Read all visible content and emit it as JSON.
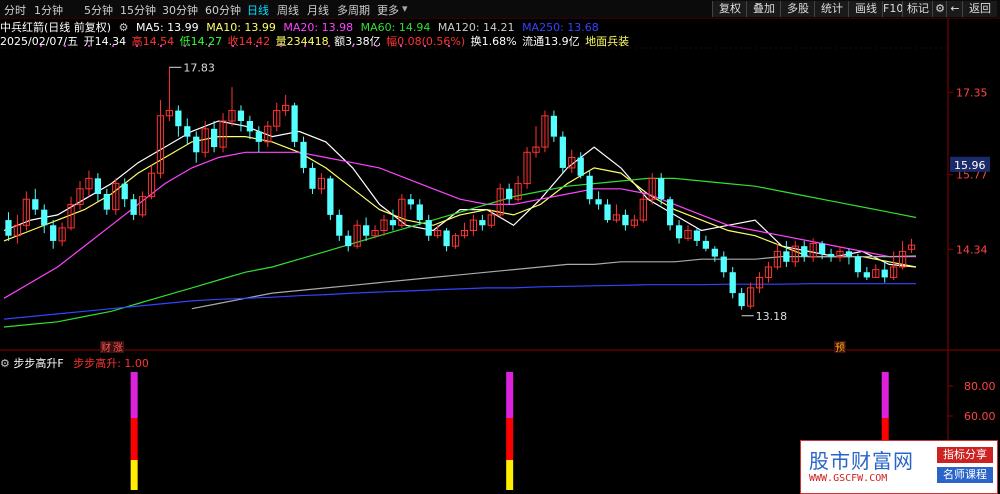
{
  "toolbar": {
    "timeframes": [
      "分时",
      "1分钟",
      "5分钟",
      "15分钟",
      "30分钟",
      "60分钟",
      "日线",
      "周线",
      "月线",
      "多周期",
      "更多"
    ],
    "active_timeframe": "日线",
    "buttons": [
      "复权",
      "叠加",
      "多股",
      "统计",
      "画线",
      "F10",
      "标记"
    ],
    "gear_icon": "gear-icon",
    "back_button": "返回"
  },
  "header": {
    "title": "中兵红箭(日线 前复权)",
    "ma_items": [
      {
        "label": "MA5: 13.99",
        "color": "#ffffff"
      },
      {
        "label": "MA10: 13.99",
        "color": "#ffff66"
      },
      {
        "label": "MA20: 13.98",
        "color": "#ff44ff"
      },
      {
        "label": "MA60: 14.94",
        "color": "#33dd33"
      },
      {
        "label": "MA120: 14.21",
        "color": "#cccccc"
      },
      {
        "label": "MA250: 13.68",
        "color": "#3344ff"
      }
    ],
    "date": "2025/02/07/五",
    "quote_items": [
      {
        "label": "开14.34",
        "color": "#ffffff"
      },
      {
        "label": "高14.54",
        "color": "#ff3333"
      },
      {
        "label": "低14.27",
        "color": "#33ff33"
      },
      {
        "label": "收14.42",
        "color": "#ff3333"
      },
      {
        "label": "量234418",
        "color": "#ffff66"
      },
      {
        "label": "额3.38亿",
        "color": "#ffffff"
      },
      {
        "label": "幅0.08(0.56%)",
        "color": "#ff3333"
      },
      {
        "label": "换1.68%",
        "color": "#ffffff"
      },
      {
        "label": "流通13.9亿",
        "color": "#ffffff"
      },
      {
        "label": "地面兵装",
        "color": "#ffff66"
      }
    ]
  },
  "indicator": {
    "name": "步步高升F",
    "value_label": "步步高升: 1.00",
    "y_ticks": [
      "80.00",
      "60.00"
    ]
  },
  "annotations": {
    "high_label": "17.83",
    "low_label": "13.18",
    "marker_cai": "财",
    "marker_zhang": "涨",
    "marker_yu": "预"
  },
  "watermark": {
    "name": "股市财富网",
    "url": "WWW.GSCFW.COM",
    "tag1": "指标分享",
    "tag2": "名师课程"
  },
  "chart_data": {
    "type": "candlestick",
    "price_ticks": [
      "17.35",
      "15.77",
      "14.34"
    ],
    "current_price_label": "15.96",
    "ylim": [
      12.6,
      18.2
    ],
    "candles": [
      [
        14.9,
        14.6,
        15.05,
        14.5
      ],
      [
        14.6,
        14.8,
        15.0,
        14.45
      ],
      [
        14.8,
        15.3,
        15.45,
        14.7
      ],
      [
        15.3,
        15.1,
        15.5,
        15.0
      ],
      [
        15.1,
        14.8,
        15.2,
        14.65
      ],
      [
        14.8,
        14.5,
        14.9,
        14.35
      ],
      [
        14.5,
        14.75,
        14.85,
        14.4
      ],
      [
        14.75,
        15.2,
        15.35,
        14.7
      ],
      [
        15.2,
        15.5,
        15.65,
        15.1
      ],
      [
        15.5,
        15.7,
        15.85,
        15.35
      ],
      [
        15.7,
        15.4,
        15.8,
        15.25
      ],
      [
        15.4,
        15.1,
        15.5,
        15.0
      ],
      [
        15.1,
        15.6,
        15.7,
        15.0
      ],
      [
        15.6,
        15.3,
        15.7,
        15.15
      ],
      [
        15.3,
        15.0,
        15.4,
        14.9
      ],
      [
        15.0,
        15.35,
        15.45,
        14.95
      ],
      [
        15.35,
        15.8,
        15.95,
        15.3
      ],
      [
        15.8,
        16.9,
        17.2,
        15.7
      ],
      [
        16.9,
        17.0,
        17.83,
        16.8
      ],
      [
        17.0,
        16.7,
        17.1,
        16.5
      ],
      [
        16.7,
        16.5,
        16.85,
        16.35
      ],
      [
        16.5,
        16.2,
        16.6,
        16.0
      ],
      [
        16.2,
        16.65,
        16.8,
        16.1
      ],
      [
        16.65,
        16.3,
        16.8,
        16.2
      ],
      [
        16.3,
        16.8,
        16.95,
        16.2
      ],
      [
        16.8,
        17.0,
        17.45,
        16.7
      ],
      [
        17.0,
        16.8,
        17.1,
        16.6
      ],
      [
        16.8,
        16.6,
        16.9,
        16.45
      ],
      [
        16.6,
        16.4,
        16.7,
        16.2
      ],
      [
        16.4,
        16.7,
        16.8,
        16.3
      ],
      [
        16.7,
        17.0,
        17.15,
        16.6
      ],
      [
        17.0,
        17.1,
        17.3,
        16.9
      ],
      [
        17.1,
        16.4,
        17.15,
        16.3
      ],
      [
        16.4,
        15.9,
        16.5,
        15.8
      ],
      [
        15.9,
        15.5,
        16.0,
        15.4
      ],
      [
        15.5,
        15.7,
        15.8,
        15.4
      ],
      [
        15.7,
        15.0,
        15.75,
        14.9
      ],
      [
        15.0,
        14.6,
        15.1,
        14.5
      ],
      [
        14.6,
        14.4,
        14.7,
        14.3
      ],
      [
        14.4,
        14.8,
        14.9,
        14.35
      ],
      [
        14.8,
        14.6,
        14.95,
        14.5
      ],
      [
        14.6,
        14.7,
        14.8,
        14.55
      ],
      [
        14.7,
        14.9,
        15.0,
        14.6
      ],
      [
        14.9,
        14.8,
        15.1,
        14.7
      ],
      [
        14.8,
        15.3,
        15.4,
        14.75
      ],
      [
        15.3,
        15.2,
        15.4,
        15.1
      ],
      [
        15.2,
        14.9,
        15.3,
        14.8
      ],
      [
        14.9,
        14.6,
        15.0,
        14.5
      ],
      [
        14.6,
        14.7,
        14.8,
        14.55
      ],
      [
        14.7,
        14.4,
        14.75,
        14.3
      ],
      [
        14.4,
        14.6,
        14.65,
        14.35
      ],
      [
        14.6,
        14.7,
        14.85,
        14.55
      ],
      [
        14.7,
        14.9,
        15.0,
        14.6
      ],
      [
        14.9,
        14.8,
        15.0,
        14.7
      ],
      [
        14.8,
        15.0,
        15.1,
        14.75
      ],
      [
        15.0,
        15.5,
        15.6,
        14.95
      ],
      [
        15.5,
        15.3,
        15.6,
        15.2
      ],
      [
        15.3,
        15.6,
        15.75,
        15.25
      ],
      [
        15.6,
        16.2,
        16.3,
        15.5
      ],
      [
        16.2,
        16.3,
        16.7,
        16.1
      ],
      [
        16.3,
        16.9,
        17.0,
        16.2
      ],
      [
        16.9,
        16.5,
        17.0,
        16.4
      ],
      [
        16.5,
        15.9,
        16.6,
        15.8
      ],
      [
        15.9,
        16.1,
        16.25,
        15.8
      ],
      [
        16.1,
        15.75,
        16.2,
        15.7
      ],
      [
        15.75,
        15.3,
        15.85,
        15.2
      ],
      [
        15.3,
        15.2,
        15.45,
        15.1
      ],
      [
        15.2,
        14.9,
        15.3,
        14.85
      ],
      [
        14.9,
        15.0,
        15.2,
        14.85
      ],
      [
        15.0,
        14.8,
        15.1,
        14.7
      ],
      [
        14.8,
        14.9,
        15.0,
        14.75
      ],
      [
        14.9,
        15.3,
        15.4,
        14.85
      ],
      [
        15.3,
        15.7,
        15.8,
        15.2
      ],
      [
        15.7,
        15.3,
        15.8,
        15.2
      ],
      [
        15.3,
        14.8,
        15.35,
        14.7
      ],
      [
        14.8,
        14.55,
        14.9,
        14.45
      ],
      [
        14.55,
        14.7,
        14.8,
        14.5
      ],
      [
        14.7,
        14.5,
        14.75,
        14.4
      ],
      [
        14.5,
        14.35,
        14.6,
        14.3
      ],
      [
        14.35,
        14.2,
        14.4,
        14.1
      ],
      [
        14.2,
        13.9,
        14.3,
        13.8
      ],
      [
        13.9,
        13.5,
        14.0,
        13.4
      ],
      [
        13.5,
        13.25,
        13.6,
        13.18
      ],
      [
        13.25,
        13.6,
        13.7,
        13.2
      ],
      [
        13.6,
        13.8,
        13.9,
        13.5
      ],
      [
        13.8,
        14.0,
        14.1,
        13.7
      ],
      [
        14.0,
        14.3,
        14.45,
        13.95
      ],
      [
        14.3,
        14.1,
        14.5,
        14.0
      ],
      [
        14.1,
        14.4,
        14.5,
        14.0
      ],
      [
        14.4,
        14.2,
        14.5,
        14.1
      ],
      [
        14.2,
        14.45,
        14.55,
        14.1
      ],
      [
        14.45,
        14.25,
        14.5,
        14.15
      ],
      [
        14.25,
        14.2,
        14.35,
        14.1
      ],
      [
        14.2,
        14.3,
        14.4,
        14.1
      ],
      [
        14.3,
        14.2,
        14.35,
        14.05
      ],
      [
        14.2,
        13.9,
        14.25,
        13.8
      ],
      [
        13.9,
        13.8,
        14.0,
        13.75
      ],
      [
        13.8,
        13.95,
        14.05,
        13.8
      ],
      [
        13.95,
        13.8,
        14.1,
        13.7
      ],
      [
        13.8,
        14.0,
        14.3,
        13.75
      ],
      [
        14.0,
        14.3,
        14.5,
        13.95
      ],
      [
        14.34,
        14.42,
        14.54,
        14.27
      ]
    ],
    "ma_lines": [
      {
        "name": "MA5",
        "color": "#ffffff",
        "values": [
          14.7,
          14.9,
          15.0,
          15.3,
          15.6,
          16.0,
          16.3,
          16.6,
          16.8,
          16.7,
          16.5,
          16.6,
          16.4,
          15.9,
          15.2,
          14.8,
          14.7,
          15.1,
          15.1,
          14.8,
          15.3,
          15.9,
          16.3,
          15.9,
          15.3,
          15.0,
          14.7,
          14.8,
          14.9,
          14.4,
          14.3,
          14.2,
          14.3,
          14.05,
          14.0
        ]
      },
      {
        "name": "MA10",
        "color": "#ffff66",
        "values": [
          14.5,
          14.7,
          14.9,
          15.1,
          15.4,
          15.8,
          16.1,
          16.4,
          16.5,
          16.5,
          16.4,
          16.2,
          15.9,
          15.5,
          15.1,
          14.9,
          14.8,
          15.0,
          15.1,
          15.0,
          15.2,
          15.6,
          15.9,
          15.8,
          15.4,
          15.1,
          14.9,
          14.7,
          14.6,
          14.4,
          14.2,
          14.2,
          14.2,
          14.1,
          14.0
        ]
      },
      {
        "name": "MA20",
        "color": "#ff44ff",
        "values": [
          13.4,
          13.7,
          14.0,
          14.4,
          14.8,
          15.2,
          15.6,
          15.9,
          16.1,
          16.2,
          16.2,
          16.2,
          16.1,
          16.0,
          15.9,
          15.7,
          15.5,
          15.3,
          15.2,
          15.2,
          15.3,
          15.4,
          15.5,
          15.5,
          15.4,
          15.2,
          15.0,
          14.8,
          14.7,
          14.6,
          14.5,
          14.4,
          14.3,
          14.2,
          14.2
        ]
      },
      {
        "name": "MA60",
        "color": "#33dd33",
        "values": [
          12.85,
          12.9,
          12.95,
          13.05,
          13.15,
          13.3,
          13.45,
          13.6,
          13.75,
          13.9,
          14.0,
          14.15,
          14.3,
          14.45,
          14.6,
          14.75,
          14.9,
          15.05,
          15.2,
          15.35,
          15.45,
          15.55,
          15.6,
          15.65,
          15.7,
          15.7,
          15.65,
          15.6,
          15.55,
          15.45,
          15.35,
          15.25,
          15.15,
          15.05,
          14.95
        ]
      },
      {
        "name": "MA120",
        "color": "#aaaaaa",
        "values": [
          null,
          null,
          null,
          null,
          null,
          null,
          null,
          13.2,
          13.3,
          13.4,
          13.5,
          13.55,
          13.6,
          13.65,
          13.7,
          13.75,
          13.8,
          13.85,
          13.9,
          13.95,
          14.0,
          14.05,
          14.05,
          14.1,
          14.1,
          14.1,
          14.15,
          14.15,
          14.15,
          14.2,
          14.2,
          14.2,
          14.2,
          14.2,
          14.21
        ]
      },
      {
        "name": "MA250",
        "color": "#3344ff",
        "values": [
          13.0,
          13.05,
          13.1,
          13.15,
          13.2,
          13.25,
          13.3,
          13.35,
          13.38,
          13.4,
          13.42,
          13.45,
          13.47,
          13.5,
          13.52,
          13.54,
          13.56,
          13.58,
          13.6,
          13.6,
          13.62,
          13.63,
          13.64,
          13.65,
          13.66,
          13.66,
          13.66,
          13.67,
          13.67,
          13.67,
          13.68,
          13.68,
          13.68,
          13.68,
          13.68
        ]
      }
    ],
    "indicator_signals": [
      14,
      56,
      98,
      114
    ]
  }
}
